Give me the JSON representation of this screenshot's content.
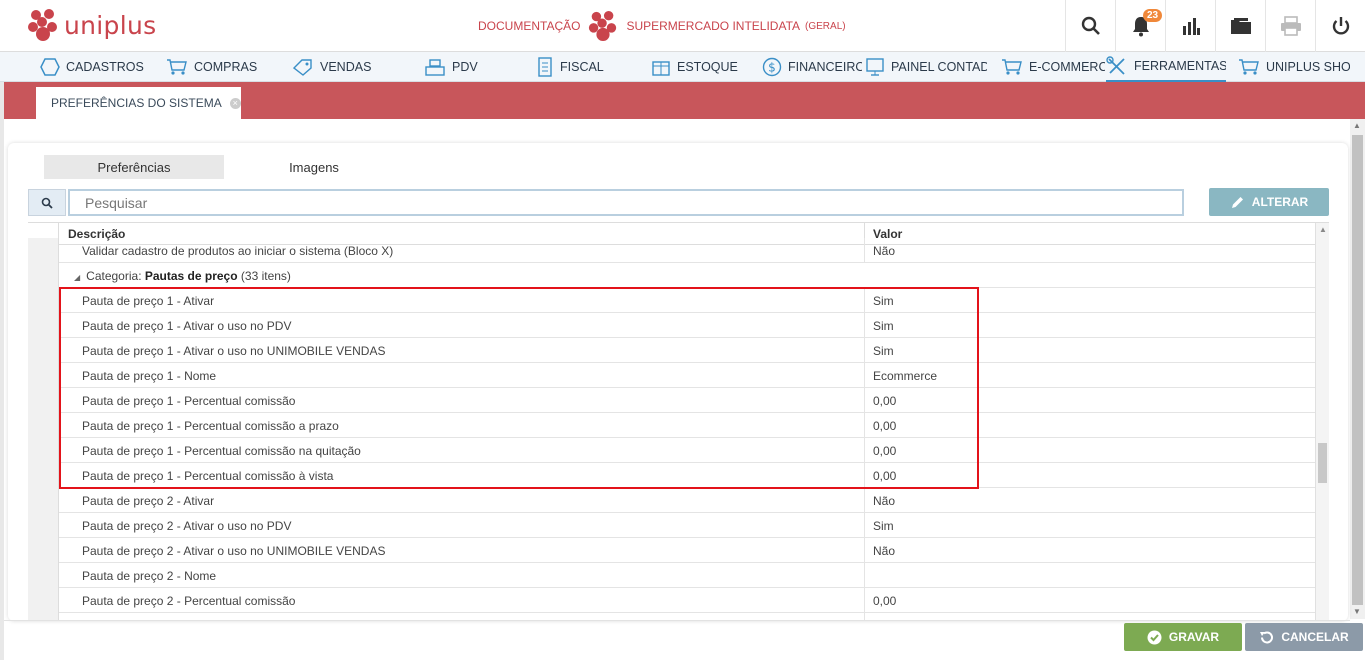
{
  "brand": {
    "logo_text": "uniplus"
  },
  "header": {
    "doc_label": "DOCUMENTAÇÃO",
    "company": "SUPERMERCADO INTELIDATA",
    "company_suffix": "(GERAL)",
    "notifications_count": "23",
    "icons": [
      "search-icon",
      "bell-icon",
      "chart-icon",
      "folder-icon",
      "printer-icon",
      "power-icon"
    ]
  },
  "nav": {
    "items": [
      {
        "label": "CADASTROS",
        "icon": "hexagon-icon"
      },
      {
        "label": "COMPRAS",
        "icon": "cart-icon"
      },
      {
        "label": "VENDAS",
        "icon": "tag-icon"
      },
      {
        "label": "PDV",
        "icon": "register-icon"
      },
      {
        "label": "FISCAL",
        "icon": "document-icon"
      },
      {
        "label": "ESTOQUE",
        "icon": "box-icon"
      },
      {
        "label": "FINANCEIRO",
        "icon": "dollar-icon"
      },
      {
        "label": "PAINEL CONTADOR",
        "icon": "monitor-icon"
      },
      {
        "label": "E-COMMERCE",
        "icon": "cart-icon"
      },
      {
        "label": "FERRAMENTAS",
        "icon": "tools-icon"
      },
      {
        "label": "UNIPLUS SHOP",
        "icon": "cart-icon"
      }
    ],
    "active": "FERRAMENTAS"
  },
  "tab": {
    "title": "PREFERÊNCIAS DO SISTEMA"
  },
  "subtabs": [
    {
      "label": "Preferências",
      "selected": true
    },
    {
      "label": "Imagens",
      "selected": false
    }
  ],
  "search": {
    "placeholder": "Pesquisar"
  },
  "buttons": {
    "alterar": "ALTERAR",
    "gravar": "GRAVAR",
    "cancelar": "CANCELAR"
  },
  "grid": {
    "columns": {
      "descricao": "Descrição",
      "valor": "Valor"
    },
    "first_row": {
      "desc": "Validar cadastro de produtos ao iniciar o sistema (Bloco X)",
      "value": "Não"
    },
    "group": {
      "prefix": "Categoria: ",
      "name": "Pautas de preço",
      "count": "(33 itens)"
    },
    "rows": [
      {
        "desc": "Pauta de preço 1 - Ativar",
        "value": "Sim"
      },
      {
        "desc": "Pauta de preço 1 - Ativar o uso no PDV",
        "value": "Sim"
      },
      {
        "desc": "Pauta de preço 1 - Ativar o uso no UNIMOBILE VENDAS",
        "value": "Sim"
      },
      {
        "desc": "Pauta de preço 1 - Nome",
        "value": "Ecommerce"
      },
      {
        "desc": "Pauta de preço 1 - Percentual comissão",
        "value": "0,00"
      },
      {
        "desc": "Pauta de preço 1 - Percentual comissão a prazo",
        "value": "0,00"
      },
      {
        "desc": "Pauta de preço 1 - Percentual comissão na quitação",
        "value": "0,00"
      },
      {
        "desc": "Pauta de preço 1 - Percentual comissão à vista",
        "value": "0,00"
      },
      {
        "desc": "Pauta de preço 2 - Ativar",
        "value": "Não"
      },
      {
        "desc": "Pauta de preço 2 - Ativar o uso no PDV",
        "value": "Sim"
      },
      {
        "desc": "Pauta de preço 2 - Ativar o uso no UNIMOBILE VENDAS",
        "value": "Não"
      },
      {
        "desc": "Pauta de preço 2 - Nome",
        "value": ""
      },
      {
        "desc": "Pauta de preço 2 - Percentual comissão",
        "value": "0,00"
      },
      {
        "desc": "",
        "value": ""
      }
    ]
  },
  "colors": {
    "brand": "#c9444c",
    "band": "#c8565b",
    "highlight": "#e3131a",
    "gravar": "#7daa52",
    "cancelar": "#8c9aa8",
    "alterar": "#8ab7c2"
  }
}
